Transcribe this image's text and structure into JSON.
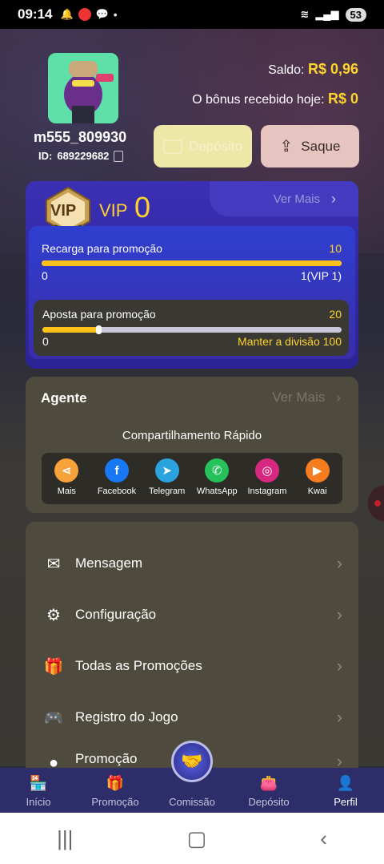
{
  "status_bar": {
    "time": "09:14",
    "battery": "53"
  },
  "profile": {
    "username": "m555_809930",
    "id_label": "ID:",
    "id_value": "689229682",
    "balance_label": "Saldo:",
    "balance_value": "R$ 0,96",
    "bonus_label": "O bônus recebido hoje:",
    "bonus_value": "R$ 0"
  },
  "actions": {
    "deposit_label": "Depósito",
    "withdraw_label": "Saque"
  },
  "vip": {
    "badge_text": "VIP",
    "label": "VIP",
    "level": "0",
    "more_label": "Ver Mais",
    "recharge": {
      "label": "Recarga para promoção",
      "target": "10",
      "current": "0",
      "next": "1(VIP 1)",
      "progress": 1.0
    },
    "bet": {
      "label": "Aposta para promoção",
      "target": "20",
      "current": "0",
      "next": "Manter a divisão 100",
      "progress": 0.19
    }
  },
  "agent": {
    "title": "Agente",
    "more_label": "Ver Mais",
    "share_title": "Compartilhamento Rápido",
    "share_items": [
      {
        "label": "Mais",
        "icon": "share-icon",
        "color": "#f7a23a"
      },
      {
        "label": "Facebook",
        "icon": "facebook-icon",
        "color": "#1877f2"
      },
      {
        "label": "Telegram",
        "icon": "telegram-icon",
        "color": "#2aa3df"
      },
      {
        "label": "WhatsApp",
        "icon": "whatsapp-icon",
        "color": "#25c15a"
      },
      {
        "label": "Instagram",
        "icon": "instagram-icon",
        "color": "#d6287f"
      },
      {
        "label": "Kwai",
        "icon": "kwai-icon",
        "color": "#f57d1f"
      }
    ]
  },
  "menu": [
    {
      "label": "Mensagem",
      "icon": "envelope-icon"
    },
    {
      "label": "Configuração",
      "icon": "gear-icon"
    },
    {
      "label": "Todas as Promoções",
      "icon": "gift-box-icon"
    },
    {
      "label": "Registro do Jogo",
      "icon": "gamepad-icon"
    },
    {
      "label": "Promoção",
      "icon": "promotion-icon"
    }
  ],
  "bottom_nav": [
    {
      "label": "Início",
      "icon": "home-shop-icon"
    },
    {
      "label": "Promoção",
      "icon": "gift-icon"
    },
    {
      "label": "Comissão",
      "icon": "handshake-icon"
    },
    {
      "label": "Depósito",
      "icon": "wallet-icon"
    },
    {
      "label": "Perfil",
      "icon": "user-icon"
    }
  ]
}
